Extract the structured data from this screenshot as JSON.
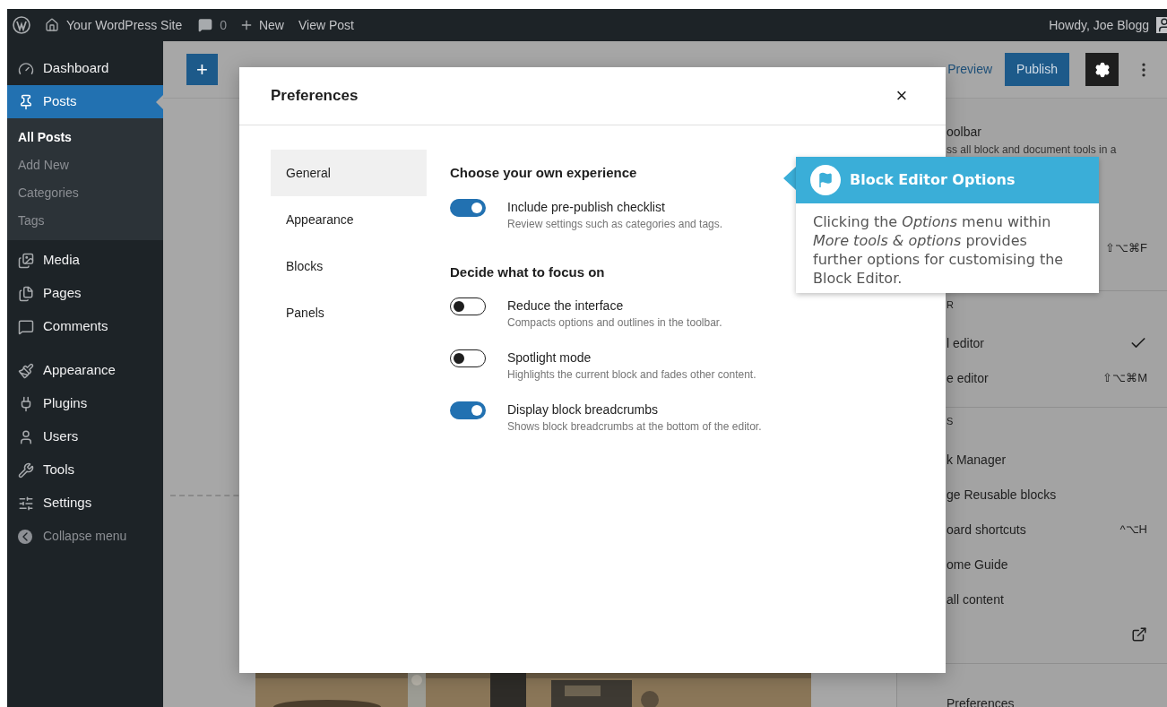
{
  "admin_bar": {
    "site": "Your WordPress Site",
    "comments": "0",
    "new": "New",
    "view": "View Post",
    "greeting": "Howdy, Joe Blogg"
  },
  "sidebar": {
    "items": [
      {
        "label": "Dashboard",
        "selected": false
      },
      {
        "label": "Posts",
        "selected": true,
        "children": [
          {
            "label": "All Posts",
            "selected": true
          },
          {
            "label": "Add New",
            "selected": false
          },
          {
            "label": "Categories",
            "selected": false
          },
          {
            "label": "Tags",
            "selected": false
          }
        ]
      },
      {
        "label": "Media",
        "selected": false
      },
      {
        "label": "Pages",
        "selected": false
      },
      {
        "label": "Comments",
        "selected": false
      },
      {
        "label": "Appearance",
        "selected": false
      },
      {
        "label": "Plugins",
        "selected": false
      },
      {
        "label": "Users",
        "selected": false
      },
      {
        "label": "Tools",
        "selected": false
      },
      {
        "label": "Settings",
        "selected": false
      }
    ],
    "collapse": "Collapse menu"
  },
  "toolbar": {
    "add": "+",
    "preview": "Preview",
    "publish": "Publish"
  },
  "more_menu": {
    "groups": [
      {
        "items": [
          {
            "kind": "item",
            "label": "oolbar",
            "description": "ss all block and document tools in a"
          },
          {
            "kind": "item",
            "shortcut": "⇧⌥⌘F"
          }
        ]
      },
      {
        "heading": "R",
        "items": [
          {
            "kind": "item",
            "label": "l editor",
            "checked": true
          },
          {
            "kind": "item",
            "label": "e editor",
            "shortcut": "⇧⌥⌘M",
            "checked": false
          }
        ]
      },
      {
        "heading": "S",
        "items": [
          {
            "kind": "item",
            "label": "k Manager"
          },
          {
            "kind": "item",
            "label": "ge Reusable blocks"
          },
          {
            "kind": "item",
            "label": "oard shortcuts",
            "shortcut": "^⌥H"
          },
          {
            "kind": "item",
            "label": "ome Guide"
          },
          {
            "kind": "item",
            "label": "all content"
          },
          {
            "kind": "link"
          }
        ]
      },
      {
        "items": [
          {
            "kind": "item",
            "label": "Preferences"
          }
        ]
      }
    ]
  },
  "preferences": {
    "title": "Preferences",
    "close": "×",
    "tabs": [
      {
        "label": "General",
        "selected": true
      },
      {
        "label": "Appearance",
        "selected": false
      },
      {
        "label": "Blocks",
        "selected": false
      },
      {
        "label": "Panels",
        "selected": false
      }
    ],
    "sections": [
      {
        "heading": "Choose your own experience",
        "options": [
          {
            "label": "Include pre-publish checklist",
            "description": "Review settings such as categories and tags.",
            "on": true
          }
        ]
      },
      {
        "heading": "Decide what to focus on",
        "options": [
          {
            "label": "Reduce the interface",
            "description": "Compacts options and outlines in the toolbar.",
            "on": false
          },
          {
            "label": "Spotlight mode",
            "description": "Highlights the current block and fades other content.",
            "on": false
          },
          {
            "label": "Display block breadcrumbs",
            "description": "Shows block breadcrumbs at the bottom of the editor.",
            "on": true
          }
        ]
      }
    ]
  },
  "callout": {
    "title": "Block Editor Options",
    "body": "Clicking the *Options* menu within *More tools & options* provides further options for customising the Block Editor."
  }
}
